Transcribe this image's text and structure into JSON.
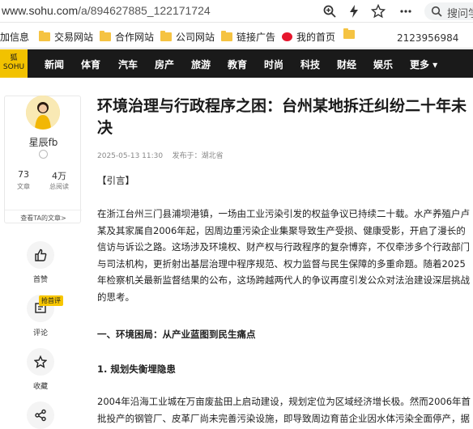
{
  "browser": {
    "url_prefix": "www.sohu.com",
    "url_path": "/a/894627885_122171724",
    "search_placeholder": "搜问学"
  },
  "bookmarks": {
    "items": [
      {
        "label": "加信息"
      },
      {
        "label": "交易网站"
      },
      {
        "label": "合作网站"
      },
      {
        "label": "公司网站"
      },
      {
        "label": "链接广告"
      },
      {
        "label": "我的首页"
      }
    ],
    "number": "2123956984"
  },
  "nav": {
    "logo": "狐\nSOHU",
    "items": [
      "新闻",
      "体育",
      "汽车",
      "房产",
      "旅游",
      "教育",
      "时尚",
      "科技",
      "财经",
      "娱乐",
      "更多 ▾"
    ]
  },
  "author": {
    "name": "星辰fb",
    "articles_count": "73",
    "articles_label": "文章",
    "reads_count": "4万",
    "reads_label": "总阅读",
    "link": "查看TA的文章>"
  },
  "actions": {
    "like": "首赞",
    "comment": "评论",
    "comment_badge": "抢首评",
    "collect": "收藏"
  },
  "article": {
    "title": "环境治理与行政程序之困：台州某地拆迁纠纷二十年未决",
    "date": "2025-05-13 11:30",
    "publish": "发布于：湖北省",
    "intro": "【引言】",
    "p1": "在浙江台州三门县浦坝港镇，一场由工业污染引发的权益争议已持续二十载。水产养殖户卢某及其家属自2006年起，因周边重污染企业集聚导致生产受损、健康受影，开启了漫长的信访与诉讼之路。这场涉及环境权、财产权与行政程序的复杂博弈，不仅牵涉多个行政部门与司法机构，更折射出基层治理中程序规范、权力监督与民生保障的多重命题。随着2025年检察机关最新监督结果的公布，这场跨越两代人的争议再度引发公众对法治建设深层挑战的思考。",
    "h1": "一、环境困局：从产业蓝图到民生痛点",
    "h2": "1. 规划失衡埋隐患",
    "p2": "2004年沿海工业城在万亩废盐田上启动建设，规划定位为区域经济增长极。然而2006年首批投产的钢管厂、皮革厂尚未完善污染设施，即导致周边育苗企业因水体污染全面停产，据"
  }
}
